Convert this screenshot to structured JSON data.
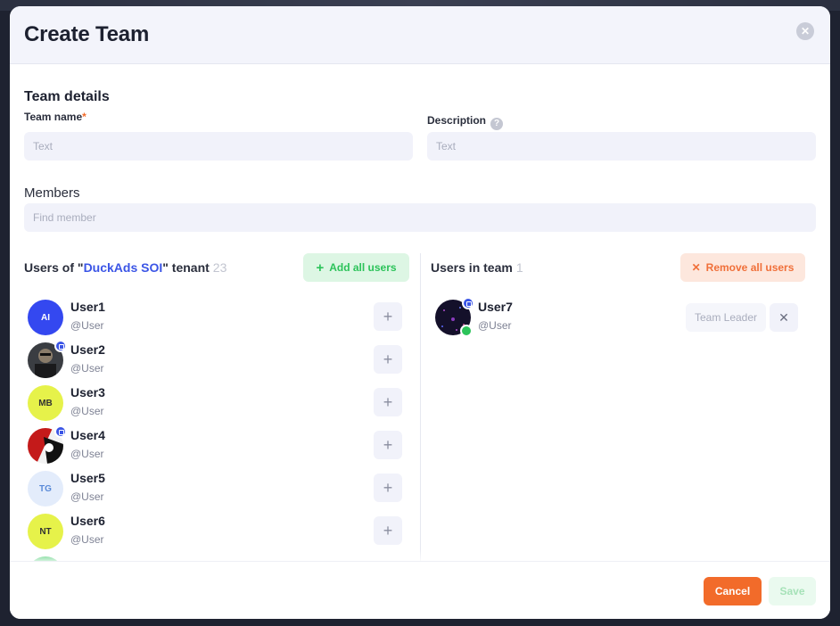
{
  "modal": {
    "title": "Create Team",
    "close_icon": "close-icon"
  },
  "details": {
    "section_title": "Team details",
    "team_name_label": "Team name",
    "required_mark": "*",
    "team_name_placeholder": "Text",
    "description_label": "Description",
    "help_icon": "?",
    "description_placeholder": "Text"
  },
  "members": {
    "title": "Members",
    "search_placeholder": "Find member"
  },
  "tenant_users": {
    "title_prefix": "Users of \"",
    "tenant_name": "DuckAds SOI",
    "title_suffix": "\" tenant",
    "count": "23",
    "add_all_label": "Add all users",
    "users": [
      {
        "name": "User1",
        "handle": "@User",
        "initials": "AI",
        "avatar_bg": "#3448f0",
        "avatar_fg": "#ffffff"
      },
      {
        "name": "User2",
        "handle": "@User",
        "initials": "",
        "avatar_bg": "#2b2b2b",
        "avatar_fg": "#ffffff"
      },
      {
        "name": "User3",
        "handle": "@User",
        "initials": "MB",
        "avatar_bg": "#e6f24a",
        "avatar_fg": "#333333"
      },
      {
        "name": "User4",
        "handle": "@User",
        "initials": "",
        "avatar_bg": "#c41a1a",
        "avatar_fg": "#ffffff"
      },
      {
        "name": "User5",
        "handle": "@User",
        "initials": "TG",
        "avatar_bg": "#e3ecfb",
        "avatar_fg": "#5a8ad8"
      },
      {
        "name": "User6",
        "handle": "@User",
        "initials": "NT",
        "avatar_bg": "#e6f24a",
        "avatar_fg": "#333333"
      }
    ]
  },
  "team_users": {
    "title": "Users in team",
    "count": "1",
    "remove_all_label": "Remove all users",
    "member": {
      "name": "User7",
      "handle": "@User",
      "role_placeholder": "Team Leader"
    }
  },
  "footer": {
    "cancel_label": "Cancel",
    "save_label": "Save"
  },
  "colors": {
    "accent": "#3b55e6",
    "primary": "#f26b2a",
    "success": "#2cc35a"
  }
}
